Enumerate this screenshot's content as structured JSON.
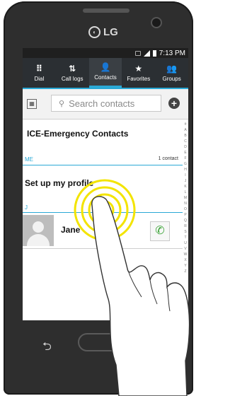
{
  "device": {
    "brand": "LG"
  },
  "status": {
    "time": "7:13 PM"
  },
  "tabs": [
    {
      "label": "Dial",
      "icon": "dialpad-icon",
      "glyph": "⠿"
    },
    {
      "label": "Call logs",
      "icon": "call-logs-icon",
      "glyph": "⇅"
    },
    {
      "label": "Contacts",
      "icon": "contacts-icon",
      "glyph": "👤",
      "active": true
    },
    {
      "label": "Favorites",
      "icon": "star-icon",
      "glyph": "★"
    },
    {
      "label": "Groups",
      "icon": "groups-icon",
      "glyph": "👥"
    }
  ],
  "search": {
    "placeholder": "Search contacts"
  },
  "contacts_list": {
    "ice_label": "ICE-Emergency Contacts",
    "section_me": "ME",
    "me_count": "1 contact",
    "setup_profile": "Set up my profile",
    "section_j": "J",
    "contact_name": "Jane"
  },
  "alphabet": [
    "#",
    "A",
    "B",
    "C",
    "D",
    "E",
    "F",
    "G",
    "H",
    "I",
    "J",
    "K",
    "L",
    "M",
    "N",
    "O",
    "P",
    "Q",
    "R",
    "S",
    "T",
    "U",
    "V",
    "W",
    "X",
    "Y",
    "Z"
  ],
  "colors": {
    "accent": "#2aa9d6",
    "phone_body": "#2e2e2e",
    "call_green": "#3aa335",
    "touch_ring": "#f3e400"
  }
}
